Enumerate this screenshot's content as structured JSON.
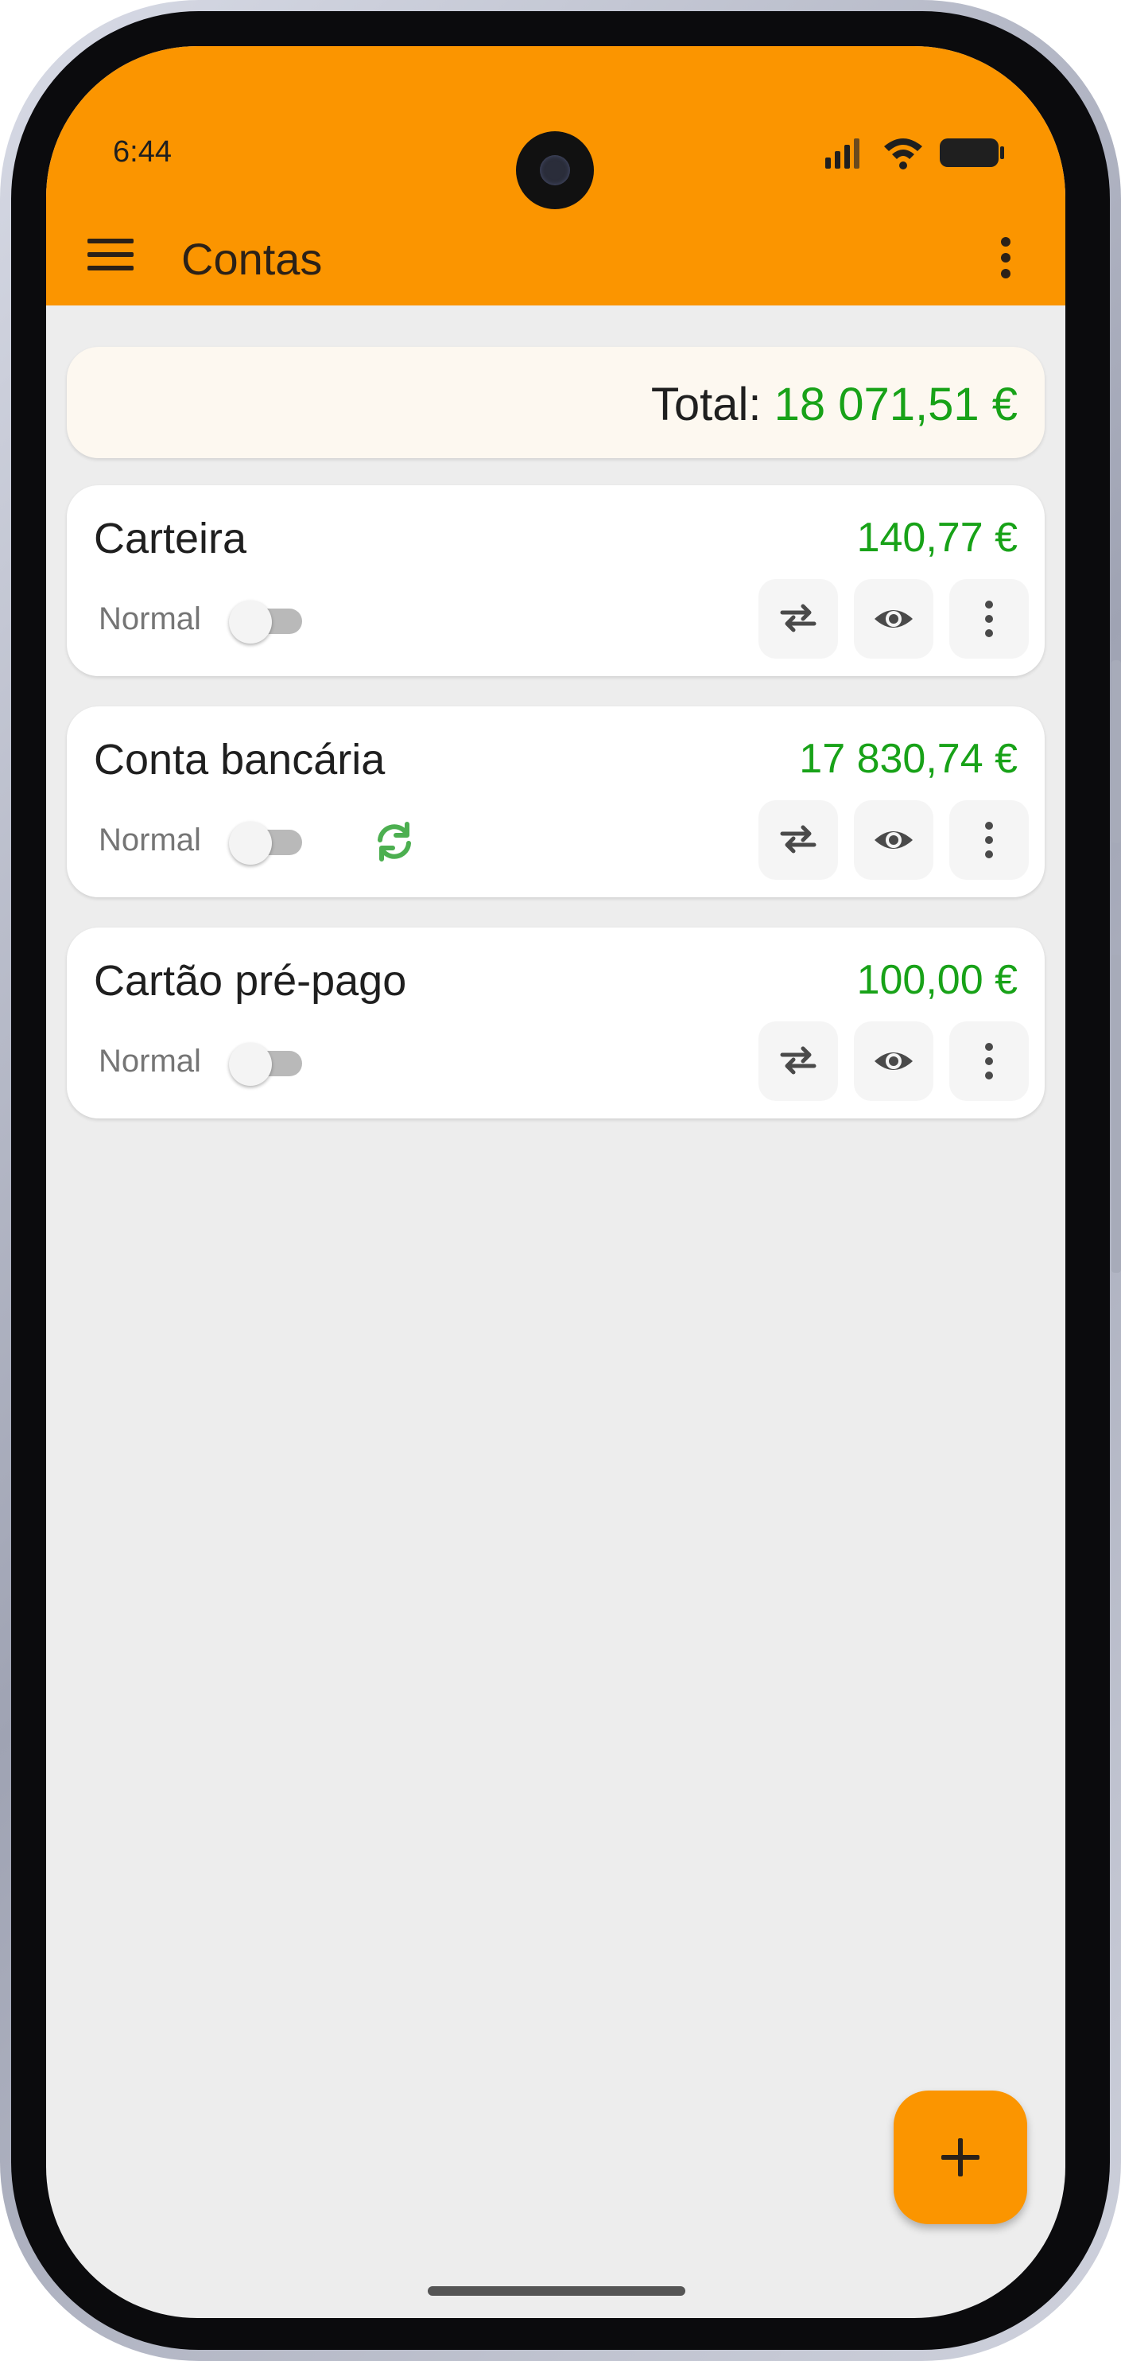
{
  "status_bar": {
    "time": "6:44",
    "icons": [
      "signal-icon",
      "wifi-icon",
      "battery-icon"
    ]
  },
  "app_bar": {
    "title": "Contas",
    "menu_icon": "hamburger-menu-icon",
    "overflow_icon": "more-vertical-icon",
    "color": "#fb9500"
  },
  "total": {
    "label": "Total:",
    "value": "18 071,51 €"
  },
  "accounts": [
    {
      "name": "Carteira",
      "amount": "140,77 €",
      "mode": "Normal",
      "toggle_on": false,
      "synced": false
    },
    {
      "name": "Conta bancária",
      "amount": "17 830,74 €",
      "mode": "Normal",
      "toggle_on": false,
      "synced": true
    },
    {
      "name": "Cartão pré-pago",
      "amount": "100,00 €",
      "mode": "Normal",
      "toggle_on": false,
      "synced": false
    }
  ],
  "account_actions": [
    "transfer-icon",
    "visibility-icon",
    "more-vertical-icon"
  ],
  "fab": {
    "icon": "plus-icon"
  },
  "colors": {
    "accent": "#fb9500",
    "positive_amount": "#18a218",
    "background": "#ededed",
    "sync": "#4caf50"
  }
}
